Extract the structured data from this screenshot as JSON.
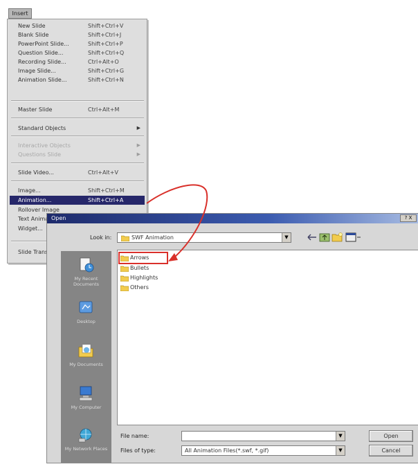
{
  "menu": {
    "title": "Insert",
    "items": [
      {
        "label": "New Slide",
        "shortcut": "Shift+Ctrl+V",
        "state": "normal"
      },
      {
        "label": "Blank Slide",
        "shortcut": "Shift+Ctrl+J",
        "state": "normal"
      },
      {
        "label": "PowerPoint Slide...",
        "shortcut": "Shift+Ctrl+P",
        "state": "normal"
      },
      {
        "label": "Question Slide...",
        "shortcut": "Shift+Ctrl+Q",
        "state": "normal"
      },
      {
        "label": "Recording Slide...",
        "shortcut": "Ctrl+Alt+O",
        "state": "normal"
      },
      {
        "label": "Image Slide...",
        "shortcut": "Shift+Ctrl+G",
        "state": "normal"
      },
      {
        "label": "Animation Slide...",
        "shortcut": "Shift+Ctrl+N",
        "state": "normal"
      },
      {
        "label": "Master Slide",
        "shortcut": "Ctrl+Alt+M",
        "state": "normal"
      },
      {
        "label": "Standard Objects",
        "shortcut": "",
        "state": "submenu"
      },
      {
        "label": "Interactive Objects",
        "shortcut": "",
        "state": "disabled"
      },
      {
        "label": "Questions Slide",
        "shortcut": "",
        "state": "disabled"
      },
      {
        "label": "Slide Video...",
        "shortcut": "Ctrl+Alt+V",
        "state": "normal"
      },
      {
        "label": "Image...",
        "shortcut": "Shift+Ctrl+M",
        "state": "normal"
      },
      {
        "label": "Animation...",
        "shortcut": "Shift+Ctrl+A",
        "state": "selected"
      },
      {
        "label": "Rollover Image",
        "shortcut": "",
        "state": "normal"
      },
      {
        "label": "Text Animation...",
        "shortcut": "",
        "state": "normal"
      },
      {
        "label": "Widget...",
        "shortcut": "",
        "state": "normal"
      },
      {
        "label": "Slide Transition",
        "shortcut": "",
        "state": "normal"
      }
    ]
  },
  "dialog": {
    "title": "Open",
    "title_button": "? X",
    "look_in_label": "Look in:",
    "look_in_value": "SWF Animation",
    "places": [
      {
        "label": "My Recent Documents",
        "icon": "recent-documents-icon"
      },
      {
        "label": "Desktop",
        "icon": "desktop-icon"
      },
      {
        "label": "My Documents",
        "icon": "my-documents-icon"
      },
      {
        "label": "My Computer",
        "icon": "my-computer-icon"
      },
      {
        "label": "My Network Places",
        "icon": "my-network-icon"
      }
    ],
    "files": [
      "Arrows",
      "Bullets",
      "Highlights",
      "Others"
    ],
    "file_name_label": "File name:",
    "file_name_value": "",
    "files_of_type_label": "Files of type:",
    "files_of_type_value": "All Animation Files(*.swf, *.gif)",
    "open_button": "Open",
    "cancel_button": "Cancel"
  },
  "colors": {
    "menu_highlight": "#26276a",
    "annotation_red": "#d9302a",
    "title_bar": "#1d2a6b"
  }
}
